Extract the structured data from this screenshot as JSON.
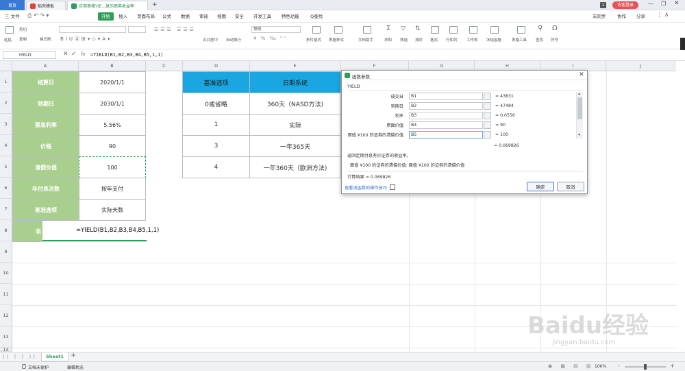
{
  "titlebar": {
    "home_tab": "首页",
    "tab1": "稻壳模板",
    "tab2": "应用表格YIE...息的债券收益率",
    "badge": "1",
    "login": "访客登录"
  },
  "menubar": {
    "file": "三 文件",
    "items": [
      "开始",
      "插入",
      "页面布局",
      "公式",
      "数据",
      "审阅",
      "视图",
      "安全",
      "开发工具",
      "特色功能"
    ],
    "search": "Q查找",
    "unsync": "未同步",
    "collab": "协作",
    "share": "分享"
  },
  "ribbon": {
    "paste": "粘贴",
    "cut": "剪切",
    "copy": "复制",
    "format_painter": "格式刷",
    "font_size": "",
    "merge": "合并居中",
    "wrap": "自动换行",
    "number_format": "常规",
    "cond_format": "条件格式",
    "table_style": "表格样式",
    "doc_helper": "文档助手",
    "sum": "求和",
    "filter": "筛选",
    "sort": "排序",
    "format": "格式",
    "rowcol": "行和列",
    "worksheet": "工作表",
    "freeze": "冻结窗格",
    "table_tools": "表格工具",
    "find": "查找",
    "symbol": "符号"
  },
  "formula_bar": {
    "name_box": "YIELD",
    "fx": "fx",
    "formula": "=YIELD(B1,B2,B3,B4,B5,1,1)"
  },
  "columns": [
    "A",
    "B",
    "C",
    "D",
    "E",
    "F",
    "G",
    "H",
    "I",
    "J"
  ],
  "rows": [
    "1",
    "2",
    "3",
    "4",
    "5",
    "6",
    "7",
    "8",
    "9",
    "10",
    "11",
    "12",
    "13",
    "14"
  ],
  "table_left": [
    {
      "label": "结算日",
      "value": "2020/1/1"
    },
    {
      "label": "到期日",
      "value": "2030/1/1"
    },
    {
      "label": "票息利率",
      "value": "5.56%"
    },
    {
      "label": "价格",
      "value": "90"
    },
    {
      "label": "清偿价值",
      "value": "100"
    },
    {
      "label": "年付息次数",
      "value": "按年支付"
    },
    {
      "label": "基准选项",
      "value": "实际天数"
    }
  ],
  "row8": {
    "label": "收",
    "formula": "=YIELD(B1,B2,B3,B4,B5,1,1)"
  },
  "table_right": {
    "headers": [
      "基准选项",
      "日期系统"
    ],
    "rows": [
      [
        "0或省略",
        "360天（NASD方法)"
      ],
      [
        "1",
        "实际"
      ],
      [
        "3",
        "一年365天"
      ],
      [
        "4",
        "一年360天（欧洲方法)"
      ]
    ]
  },
  "dialog": {
    "title": "函数参数",
    "func": "YIELD",
    "args": [
      {
        "label": "成交日",
        "input": "B1",
        "result": "= 43831"
      },
      {
        "label": "到期日",
        "input": "B2",
        "result": "= 47484"
      },
      {
        "label": "利率",
        "input": "B3",
        "result": "= 0.0556"
      },
      {
        "label": "票面价值",
        "input": "B4",
        "result": "= 90"
      },
      {
        "label": "面值 ¥100 的证券的清偿价值",
        "input": "B5",
        "result": "= 100"
      }
    ],
    "total": "= 0.069826",
    "desc": "返回定期付息有价证券的收益率。",
    "arg_desc": "面值 ¥100 的证券的清偿价值:   面值 ¥100 的证券的清偿价值",
    "calc_result": "计算结果 =  0.069826",
    "help_link": "查看该函数的操作技巧",
    "ok": "确定",
    "cancel": "取消"
  },
  "sheetbar": {
    "sheet": "Sheet1",
    "add": "+"
  },
  "statusbar": {
    "protect": "文档未保护",
    "edit_state": "编辑状态",
    "zoom": "100%",
    "minus": "-",
    "plus": "+"
  },
  "watermark": {
    "brand": "Baidu经验",
    "url": "jingyan.baidu.com"
  },
  "colors": {
    "green": "#a9cf8e",
    "blue": "#1aa6e0",
    "accent": "#2f9c5a",
    "tab_blue": "#3a78d6"
  }
}
